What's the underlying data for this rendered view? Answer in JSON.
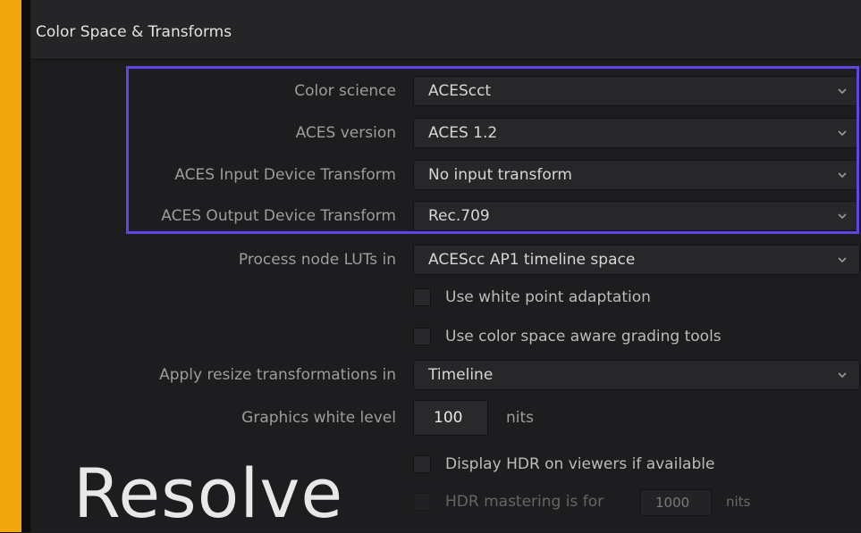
{
  "panel": {
    "title": "Color Space & Transforms"
  },
  "rows": [
    {
      "label": "Color science",
      "value": "ACEScct"
    },
    {
      "label": "ACES version",
      "value": "ACES 1.2"
    },
    {
      "label": "ACES Input Device Transform",
      "value": "No input transform"
    },
    {
      "label": "ACES Output Device Transform",
      "value": "Rec.709"
    },
    {
      "label": "Process node LUTs in",
      "value": "ACEScc AP1 timeline space"
    }
  ],
  "checkboxes": [
    {
      "label": "Use white point adaptation",
      "checked": false
    },
    {
      "label": "Use color space aware grading tools",
      "checked": false
    }
  ],
  "resize": {
    "label": "Apply resize transformations in",
    "value": "Timeline"
  },
  "graphics": {
    "label": "Graphics white level",
    "value": "100",
    "unit": "nits"
  },
  "hdr_viewers": {
    "label": "Display HDR on viewers if available",
    "checked": false
  },
  "hdr_mastering": {
    "label": "HDR mastering is for",
    "value": "1000",
    "unit": "nits",
    "checked": false
  },
  "watermark": {
    "text": "Resolve"
  },
  "colors": {
    "accent": "#f2a70f",
    "highlight": "#5f46e6"
  },
  "icons": {
    "dropdown": "chevron-down-icon"
  }
}
